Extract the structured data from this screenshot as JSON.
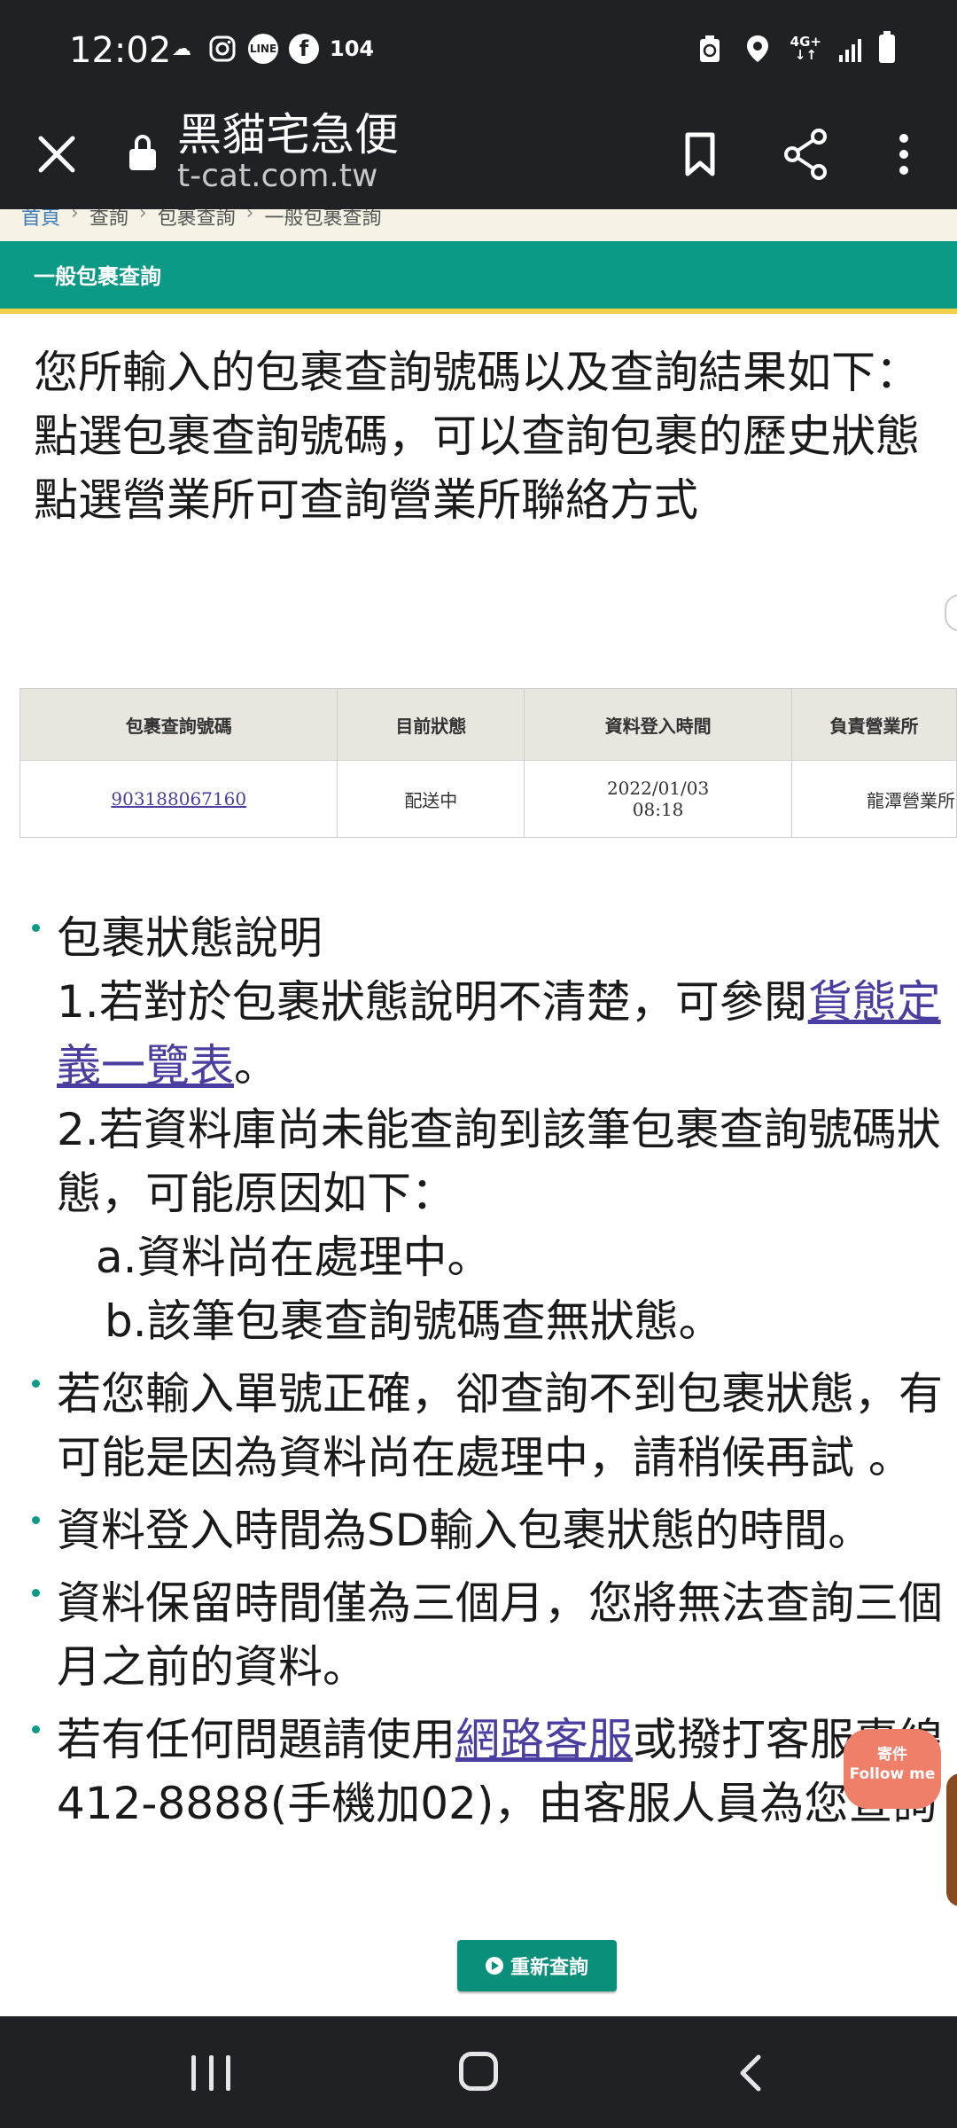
{
  "status_bar": {
    "time": "12:02",
    "left_icons": [
      "weather-icon",
      "instagram-icon",
      "line-icon",
      "facebook-icon"
    ],
    "line_label": "LINE",
    "notification_count": "104",
    "network_label": "4G+"
  },
  "browser": {
    "page_title": "黑貓宅急便",
    "url": "t-cat.com.tw"
  },
  "breadcrumb": [
    "首頁",
    "查詢",
    "包裹查詢",
    "一般包裹查詢"
  ],
  "section": {
    "title": "一般包裹查詢"
  },
  "intro": {
    "line1": "您所輸入的包裹查詢號碼以及查詢結果如下：",
    "line2": "點選包裹查詢號碼，可以查詢包裹的歷史狀態",
    "line3": "點選營業所可查詢營業所聯絡方式"
  },
  "table": {
    "headers": [
      "包裹查詢號碼",
      "目前狀態",
      "資料登入時間",
      "負責營業所"
    ],
    "row": {
      "tracking_number": "903188067160",
      "status": "配送中",
      "date": "2022/01/03",
      "time": "08:18",
      "office": "龍潭營業所"
    }
  },
  "notes": {
    "n1_title": "包裹狀態說明",
    "n1_p1_text": "1.若對於包裹狀態說明不清楚，可參閱",
    "n1_p1_link_a": "貨態定",
    "n1_p1_link_b": "義一覽表",
    "n1_p1_end": "。",
    "n1_p2_line1": "2.若資料庫尚未能查詢到該筆包裹查詢號碼狀",
    "n1_p2_line2": "態，可能原因如下：",
    "n1_a": "a.資料尚在處理中。",
    "n1_b": "b.該筆包裹查詢號碼查無狀態。",
    "n2_line1": "若您輸入單號正確，卻查詢不到包裹狀態，有",
    "n2_line2": "可能是因為資料尚在處理中，請稍候再試 。",
    "n3": "資料登入時間為SD輸入包裹狀態的時間。",
    "n4_line1": "資料保留時間僅為三個月，您將無法查詢三個",
    "n4_line2": "月之前的資料。",
    "n5_pre": "若有任何問題請使用",
    "n5_link": "網路客服",
    "n5_post": "或撥打客服專線",
    "n5_line2": "412-8888(手機加02)，由客服人員為您查詢"
  },
  "retry_button": {
    "label": "重新查詢"
  },
  "follow_widget": {
    "line1": "寄件",
    "line2": "Follow me"
  },
  "colors": {
    "header_green": "#0a9a85",
    "header_underline": "#f1d14a",
    "link_purple": "#4a3fa0",
    "widget_coral": "#f07f6a"
  }
}
